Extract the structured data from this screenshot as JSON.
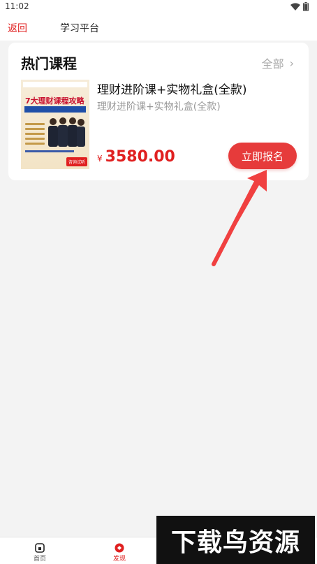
{
  "status_bar": {
    "time": "11:02"
  },
  "header": {
    "back_label": "返回",
    "title": "学习平台"
  },
  "section": {
    "title": "热门课程",
    "see_all_label": "全部"
  },
  "course": {
    "title": "理财进阶课+实物礼盒(全款)",
    "subtitle": "理财进阶课+实物礼盒(全款)",
    "price_symbol": "¥",
    "price": "3580.00",
    "signup_label": "立即报名",
    "thumbnail": {
      "headline": "7大理财课程攻略",
      "cta": "咨询试听"
    }
  },
  "bottom_nav": {
    "items": [
      {
        "label": "首页",
        "icon": "home-icon"
      },
      {
        "label": "发现",
        "icon": "discover-icon",
        "active": true
      }
    ]
  },
  "watermark": {
    "text": "下载鸟资源"
  },
  "colors": {
    "accent": "#e02020",
    "button": "#e63b3b",
    "background": "#f3f3f3"
  }
}
